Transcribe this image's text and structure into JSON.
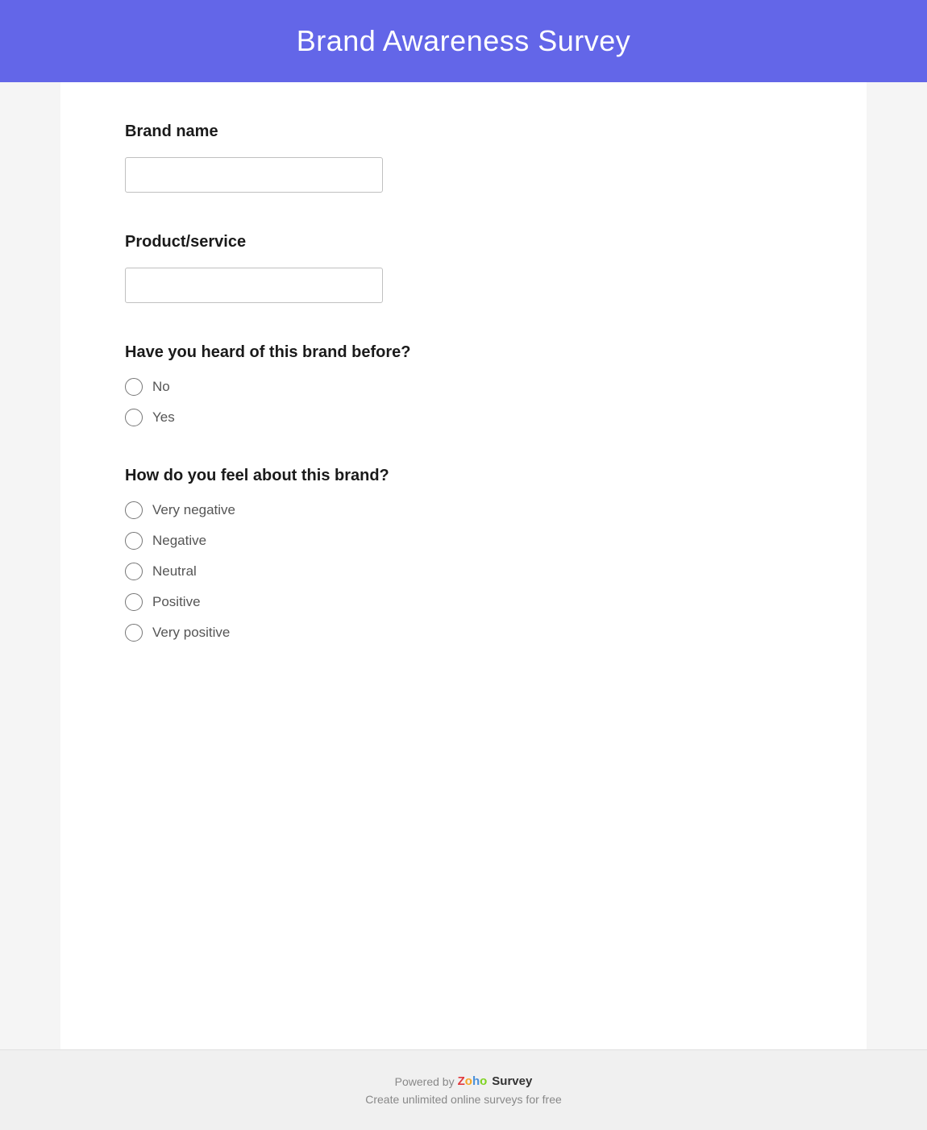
{
  "header": {
    "title": "Brand Awareness Survey",
    "background_color": "#6366e8"
  },
  "form": {
    "sections": [
      {
        "id": "brand-name",
        "label": "Brand name",
        "type": "text",
        "placeholder": ""
      },
      {
        "id": "product-service",
        "label": "Product/service",
        "type": "text",
        "placeholder": ""
      },
      {
        "id": "heard-before",
        "label": "Have you heard of this brand before?",
        "type": "radio",
        "options": [
          "No",
          "Yes"
        ]
      },
      {
        "id": "feel-about",
        "label": "How do you feel about this brand?",
        "type": "radio",
        "options": [
          "Very negative",
          "Negative",
          "Neutral",
          "Positive",
          "Very positive"
        ]
      }
    ]
  },
  "footer": {
    "powered_by": "Powered by",
    "brand_z": "Z",
    "brand_o1": "o",
    "brand_h": "h",
    "brand_o2": "o",
    "survey_label": "Survey",
    "tagline": "Create unlimited online surveys for free"
  }
}
